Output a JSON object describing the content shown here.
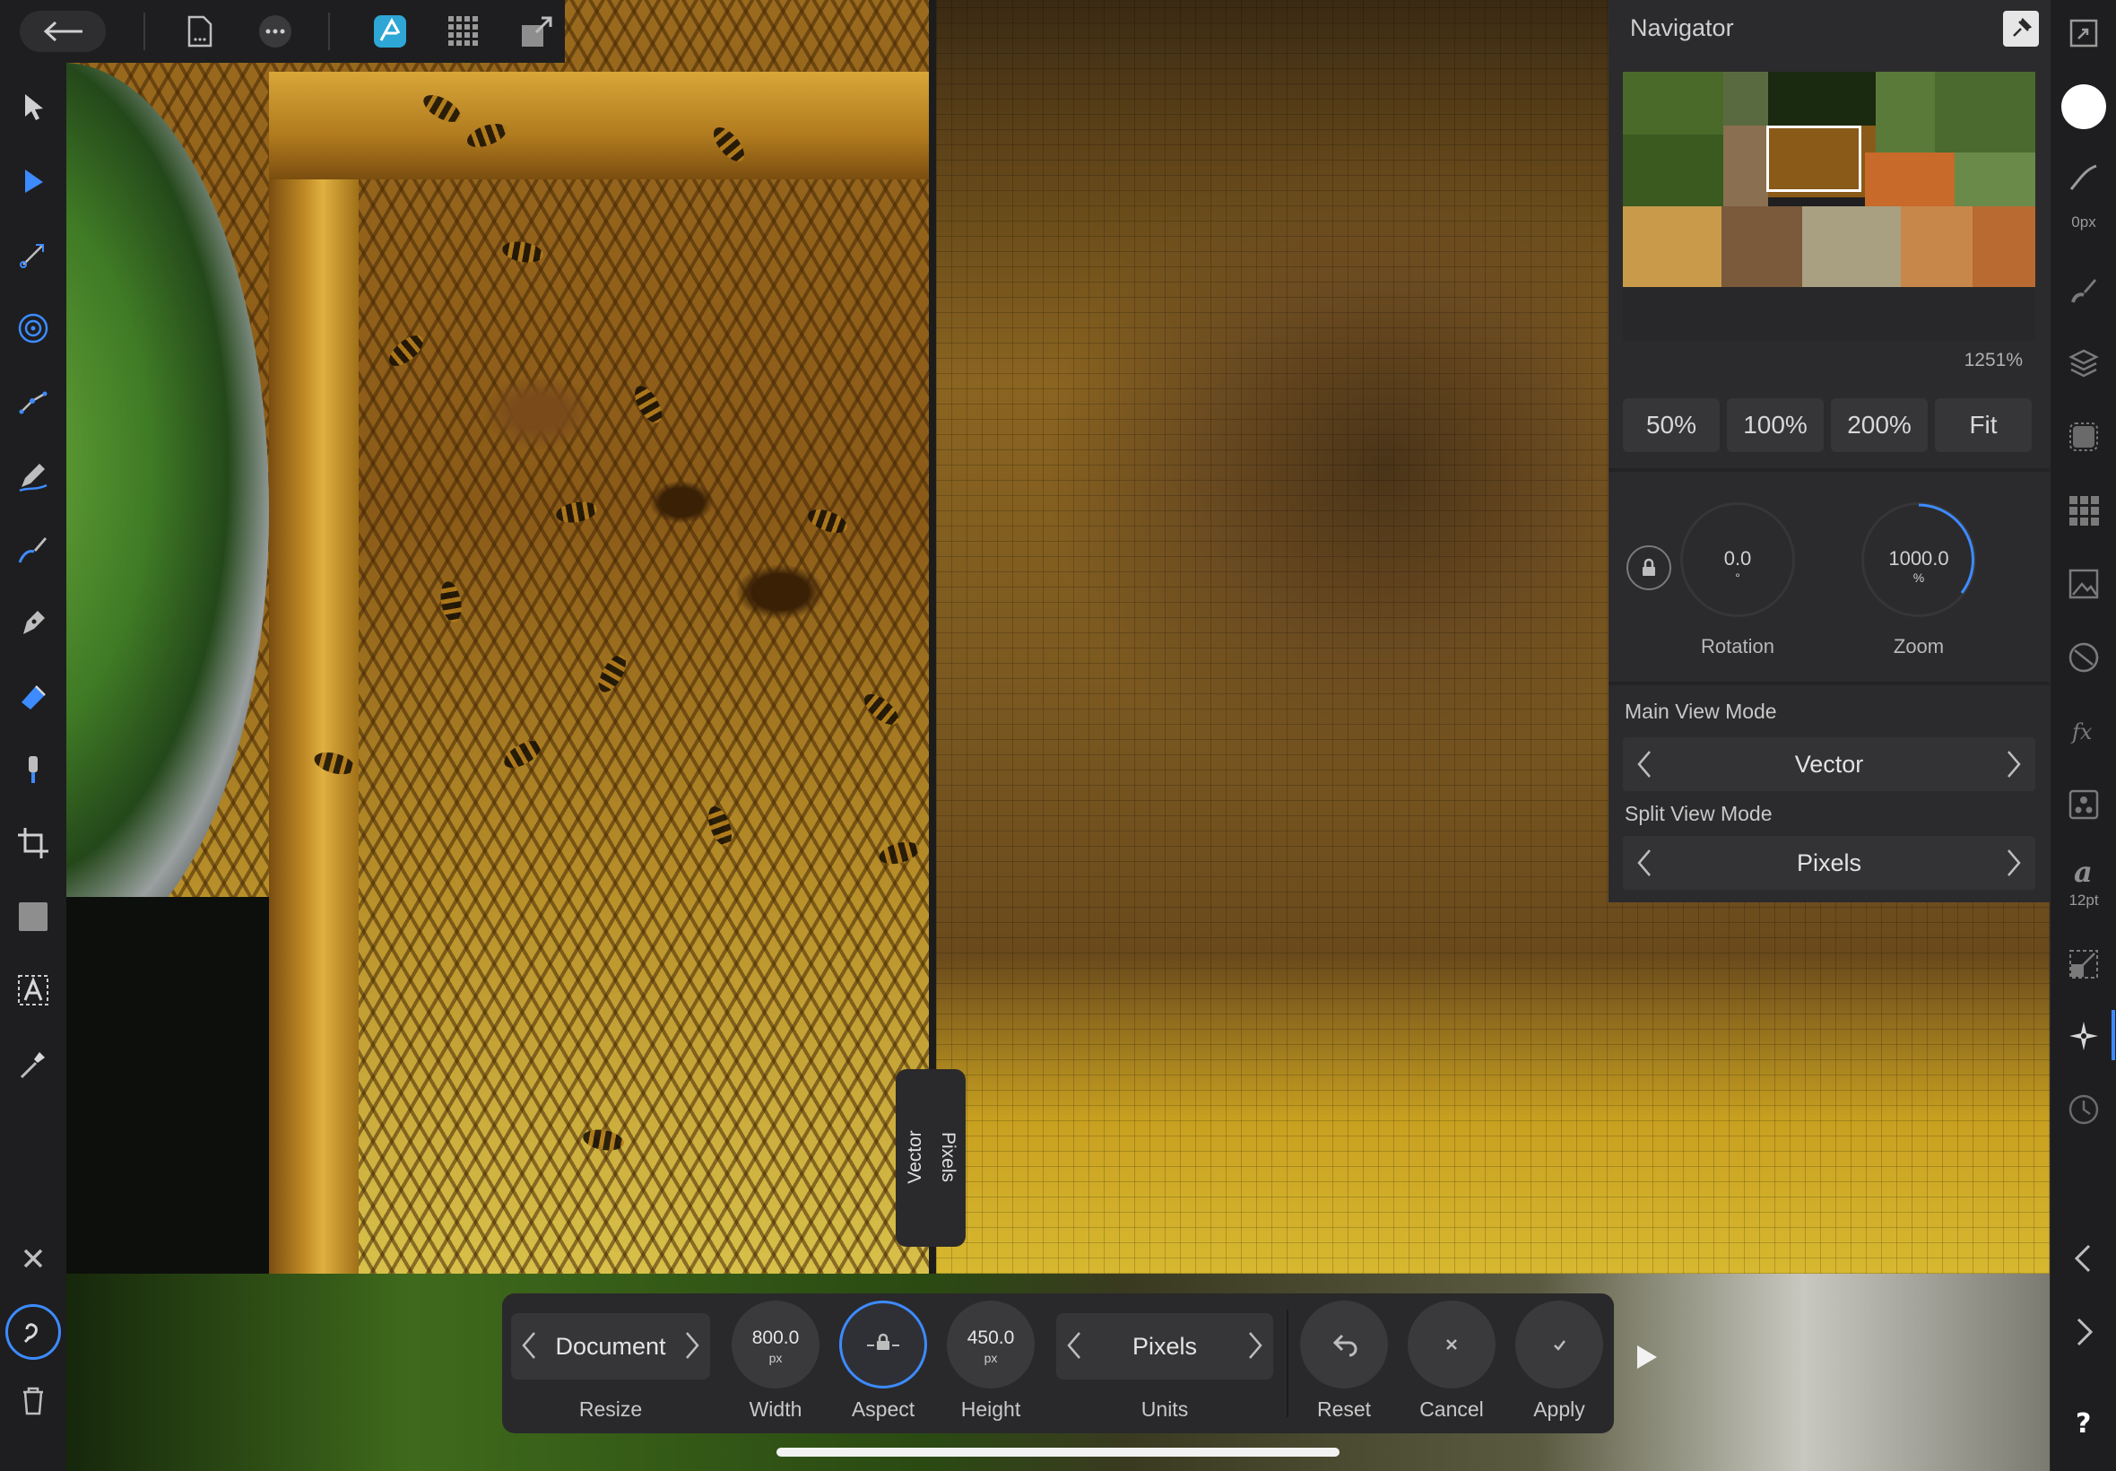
{
  "navigator": {
    "title": "Navigator",
    "zoom_readout": "1251%",
    "zoom_presets": [
      "50%",
      "100%",
      "200%",
      "Fit"
    ],
    "rotation": {
      "value": "0.0",
      "unit": "°",
      "label": "Rotation"
    },
    "zoom": {
      "value": "1000.0",
      "unit": "%",
      "label": "Zoom"
    },
    "main_view_mode": {
      "label": "Main View Mode",
      "value": "Vector"
    },
    "split_view_mode": {
      "label": "Split View Mode",
      "value": "Pixels"
    }
  },
  "split_handle": {
    "left": "Vector",
    "right": "Pixels"
  },
  "context_toolbar": {
    "resize": {
      "value": "Document",
      "label": "Resize"
    },
    "width": {
      "value": "800.0",
      "unit": "px",
      "label": "Width"
    },
    "aspect": {
      "label": "Aspect"
    },
    "height": {
      "value": "450.0",
      "unit": "px",
      "label": "Height"
    },
    "units": {
      "value": "Pixels",
      "label": "Units"
    },
    "reset": {
      "label": "Reset"
    },
    "cancel": {
      "label": "Cancel"
    },
    "apply": {
      "label": "Apply"
    }
  },
  "right_bar": {
    "brush_width_label": "0px",
    "font_size_label": "12pt"
  },
  "colors": {
    "accent": "#3d8bff",
    "panel": "#2b2b2d",
    "toolbar": "#1e1e20",
    "active_selection": "#ffffff"
  },
  "icons": {
    "top_bar": [
      "back-arrow-icon",
      "document-icon",
      "more-icon",
      "designer-persona-icon",
      "pixel-persona-icon",
      "export-persona-icon"
    ],
    "left_toolbar": [
      "move-icon",
      "node-icon",
      "corner-icon",
      "point-transform-icon",
      "contour-icon",
      "pencil-icon",
      "vector-brush-icon",
      "pen-icon",
      "fill-icon",
      "transparency-icon",
      "crop-icon",
      "rectangle-icon",
      "artistic-text-icon",
      "color-picker-icon",
      "close-icon",
      "help-icon",
      "trash-icon"
    ],
    "right_bar": [
      "fit-icon",
      "color-icon",
      "stroke-icon",
      "brush-icon",
      "layers-icon",
      "appearance-icon",
      "swatches-icon",
      "assets-icon",
      "adjustments-icon",
      "fx-icon",
      "character-icon",
      "text-style-icon",
      "transform-icon",
      "navigator-icon",
      "history-icon",
      "chevron-left-icon",
      "chevron-right-icon",
      "help-icon"
    ]
  }
}
